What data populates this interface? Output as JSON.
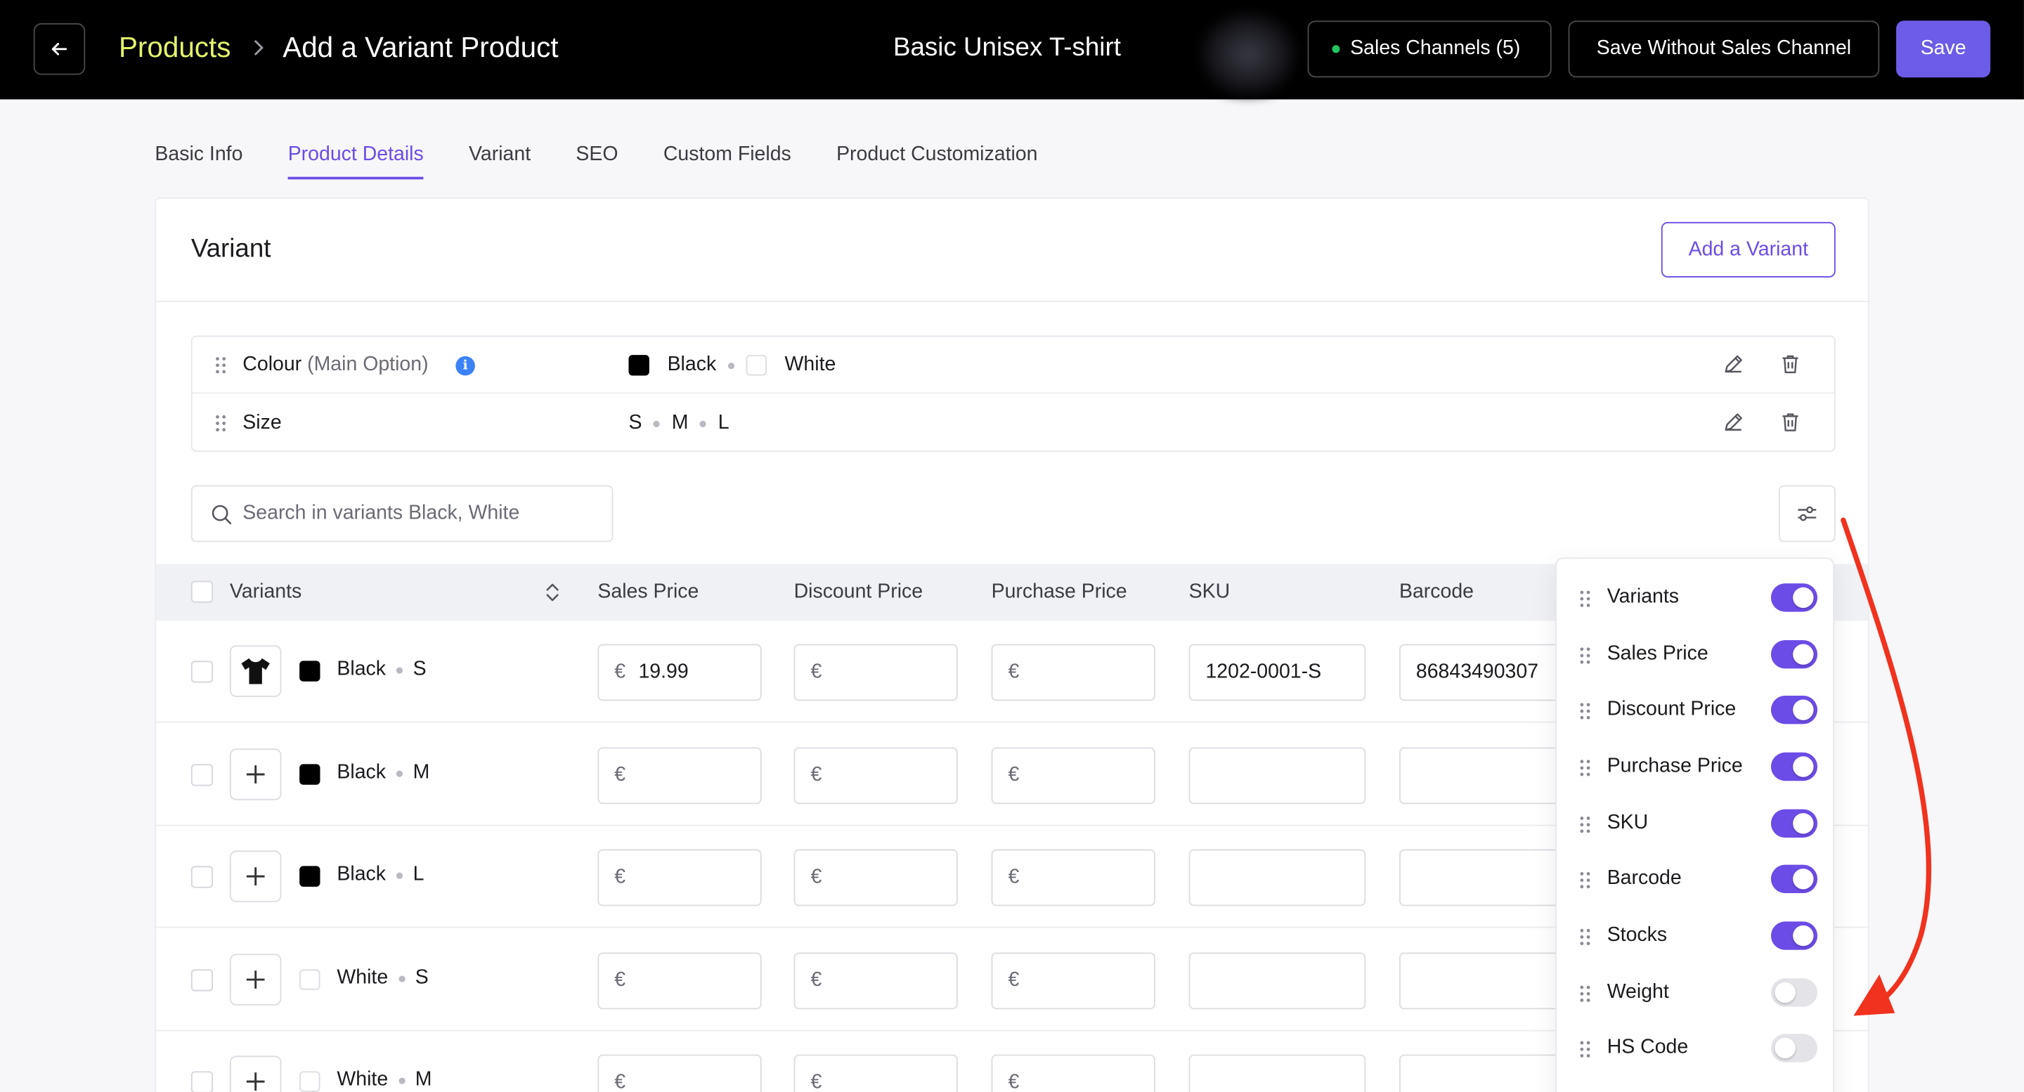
{
  "header": {
    "breadcrumb_root": "Products",
    "breadcrumb_current": "Add a Variant Product",
    "product_title": "Basic Unisex T-shirt",
    "sales_channels_label": "Sales Channels (5)",
    "save_without_label": "Save Without Sales Channel",
    "save_label": "Save"
  },
  "tabs": [
    "Basic Info",
    "Product Details",
    "Variant",
    "SEO",
    "Custom Fields",
    "Product Customization"
  ],
  "active_tab": "Product Details",
  "card": {
    "title": "Variant",
    "add_variant_label": "Add a Variant"
  },
  "options": [
    {
      "name": "Colour",
      "suffix": "(Main Option)",
      "values": [
        "Black",
        "White"
      ]
    },
    {
      "name": "Size",
      "suffix": "",
      "values": [
        "S",
        "M",
        "L"
      ]
    }
  ],
  "search": {
    "placeholder": "Search in variants Black, White"
  },
  "table": {
    "columns": [
      "Variants",
      "Sales Price",
      "Discount Price",
      "Purchase Price",
      "SKU",
      "Barcode"
    ],
    "currency": "€",
    "rows": [
      {
        "colour": "Black",
        "size": "S",
        "sales_price": "19.99",
        "sku": "1202-0001-S",
        "barcode": "86843490307",
        "has_image": true
      },
      {
        "colour": "Black",
        "size": "M",
        "sales_price": "",
        "sku": "",
        "barcode": "",
        "has_image": false
      },
      {
        "colour": "Black",
        "size": "L",
        "sales_price": "",
        "sku": "",
        "barcode": "",
        "has_image": false
      },
      {
        "colour": "White",
        "size": "S",
        "sales_price": "",
        "sku": "",
        "barcode": "",
        "has_image": false
      },
      {
        "colour": "White",
        "size": "M",
        "sales_price": "",
        "sku": "",
        "barcode": "",
        "has_image": false
      }
    ]
  },
  "column_settings": [
    {
      "label": "Variants",
      "enabled": true
    },
    {
      "label": "Sales Price",
      "enabled": true
    },
    {
      "label": "Discount Price",
      "enabled": true
    },
    {
      "label": "Purchase Price",
      "enabled": true
    },
    {
      "label": "SKU",
      "enabled": true
    },
    {
      "label": "Barcode",
      "enabled": true
    },
    {
      "label": "Stocks",
      "enabled": true
    },
    {
      "label": "Weight",
      "enabled": false
    },
    {
      "label": "HS Code",
      "enabled": false
    }
  ],
  "colors": {
    "accent": "#6c4ce6",
    "breadcrumb_root": "#e4f36b",
    "annotation_arrow": "#f0321e"
  }
}
